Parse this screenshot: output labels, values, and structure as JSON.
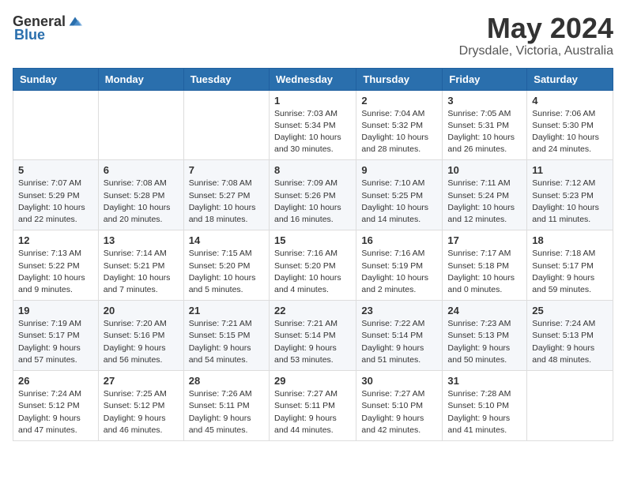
{
  "logo": {
    "text_general": "General",
    "text_blue": "Blue"
  },
  "header": {
    "month": "May 2024",
    "location": "Drysdale, Victoria, Australia"
  },
  "days_of_week": [
    "Sunday",
    "Monday",
    "Tuesday",
    "Wednesday",
    "Thursday",
    "Friday",
    "Saturday"
  ],
  "weeks": [
    [
      {
        "day": "",
        "info": ""
      },
      {
        "day": "",
        "info": ""
      },
      {
        "day": "",
        "info": ""
      },
      {
        "day": "1",
        "info": "Sunrise: 7:03 AM\nSunset: 5:34 PM\nDaylight: 10 hours\nand 30 minutes."
      },
      {
        "day": "2",
        "info": "Sunrise: 7:04 AM\nSunset: 5:32 PM\nDaylight: 10 hours\nand 28 minutes."
      },
      {
        "day": "3",
        "info": "Sunrise: 7:05 AM\nSunset: 5:31 PM\nDaylight: 10 hours\nand 26 minutes."
      },
      {
        "day": "4",
        "info": "Sunrise: 7:06 AM\nSunset: 5:30 PM\nDaylight: 10 hours\nand 24 minutes."
      }
    ],
    [
      {
        "day": "5",
        "info": "Sunrise: 7:07 AM\nSunset: 5:29 PM\nDaylight: 10 hours\nand 22 minutes."
      },
      {
        "day": "6",
        "info": "Sunrise: 7:08 AM\nSunset: 5:28 PM\nDaylight: 10 hours\nand 20 minutes."
      },
      {
        "day": "7",
        "info": "Sunrise: 7:08 AM\nSunset: 5:27 PM\nDaylight: 10 hours\nand 18 minutes."
      },
      {
        "day": "8",
        "info": "Sunrise: 7:09 AM\nSunset: 5:26 PM\nDaylight: 10 hours\nand 16 minutes."
      },
      {
        "day": "9",
        "info": "Sunrise: 7:10 AM\nSunset: 5:25 PM\nDaylight: 10 hours\nand 14 minutes."
      },
      {
        "day": "10",
        "info": "Sunrise: 7:11 AM\nSunset: 5:24 PM\nDaylight: 10 hours\nand 12 minutes."
      },
      {
        "day": "11",
        "info": "Sunrise: 7:12 AM\nSunset: 5:23 PM\nDaylight: 10 hours\nand 11 minutes."
      }
    ],
    [
      {
        "day": "12",
        "info": "Sunrise: 7:13 AM\nSunset: 5:22 PM\nDaylight: 10 hours\nand 9 minutes."
      },
      {
        "day": "13",
        "info": "Sunrise: 7:14 AM\nSunset: 5:21 PM\nDaylight: 10 hours\nand 7 minutes."
      },
      {
        "day": "14",
        "info": "Sunrise: 7:15 AM\nSunset: 5:20 PM\nDaylight: 10 hours\nand 5 minutes."
      },
      {
        "day": "15",
        "info": "Sunrise: 7:16 AM\nSunset: 5:20 PM\nDaylight: 10 hours\nand 4 minutes."
      },
      {
        "day": "16",
        "info": "Sunrise: 7:16 AM\nSunset: 5:19 PM\nDaylight: 10 hours\nand 2 minutes."
      },
      {
        "day": "17",
        "info": "Sunrise: 7:17 AM\nSunset: 5:18 PM\nDaylight: 10 hours\nand 0 minutes."
      },
      {
        "day": "18",
        "info": "Sunrise: 7:18 AM\nSunset: 5:17 PM\nDaylight: 9 hours\nand 59 minutes."
      }
    ],
    [
      {
        "day": "19",
        "info": "Sunrise: 7:19 AM\nSunset: 5:17 PM\nDaylight: 9 hours\nand 57 minutes."
      },
      {
        "day": "20",
        "info": "Sunrise: 7:20 AM\nSunset: 5:16 PM\nDaylight: 9 hours\nand 56 minutes."
      },
      {
        "day": "21",
        "info": "Sunrise: 7:21 AM\nSunset: 5:15 PM\nDaylight: 9 hours\nand 54 minutes."
      },
      {
        "day": "22",
        "info": "Sunrise: 7:21 AM\nSunset: 5:14 PM\nDaylight: 9 hours\nand 53 minutes."
      },
      {
        "day": "23",
        "info": "Sunrise: 7:22 AM\nSunset: 5:14 PM\nDaylight: 9 hours\nand 51 minutes."
      },
      {
        "day": "24",
        "info": "Sunrise: 7:23 AM\nSunset: 5:13 PM\nDaylight: 9 hours\nand 50 minutes."
      },
      {
        "day": "25",
        "info": "Sunrise: 7:24 AM\nSunset: 5:13 PM\nDaylight: 9 hours\nand 48 minutes."
      }
    ],
    [
      {
        "day": "26",
        "info": "Sunrise: 7:24 AM\nSunset: 5:12 PM\nDaylight: 9 hours\nand 47 minutes."
      },
      {
        "day": "27",
        "info": "Sunrise: 7:25 AM\nSunset: 5:12 PM\nDaylight: 9 hours\nand 46 minutes."
      },
      {
        "day": "28",
        "info": "Sunrise: 7:26 AM\nSunset: 5:11 PM\nDaylight: 9 hours\nand 45 minutes."
      },
      {
        "day": "29",
        "info": "Sunrise: 7:27 AM\nSunset: 5:11 PM\nDaylight: 9 hours\nand 44 minutes."
      },
      {
        "day": "30",
        "info": "Sunrise: 7:27 AM\nSunset: 5:10 PM\nDaylight: 9 hours\nand 42 minutes."
      },
      {
        "day": "31",
        "info": "Sunrise: 7:28 AM\nSunset: 5:10 PM\nDaylight: 9 hours\nand 41 minutes."
      },
      {
        "day": "",
        "info": ""
      }
    ]
  ]
}
